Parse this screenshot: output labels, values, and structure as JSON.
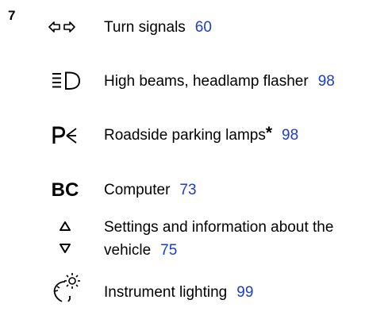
{
  "section_number": "7",
  "items": [
    {
      "icon": "turn-signals-icon",
      "label": "Turn signals",
      "ref": "60"
    },
    {
      "icon": "high-beams-icon",
      "label": "High beams, headlamp flasher",
      "ref": "98"
    },
    {
      "icon": "roadside-parking-lamps-icon",
      "label": "Roadside parking lamps",
      "star": "*",
      "ref": "98"
    },
    {
      "icon": "computer-icon",
      "icon_text": "BC",
      "label": "Computer",
      "ref": "73"
    },
    {
      "icon": "settings-arrows-icon",
      "label_line1": "Settings and information about the",
      "label_line2": "vehicle",
      "ref": "75"
    },
    {
      "icon": "instrument-lighting-icon",
      "label": "Instrument lighting",
      "ref": "99"
    }
  ],
  "colors": {
    "text": "#000000",
    "reference_link": "#1a3ccf"
  }
}
